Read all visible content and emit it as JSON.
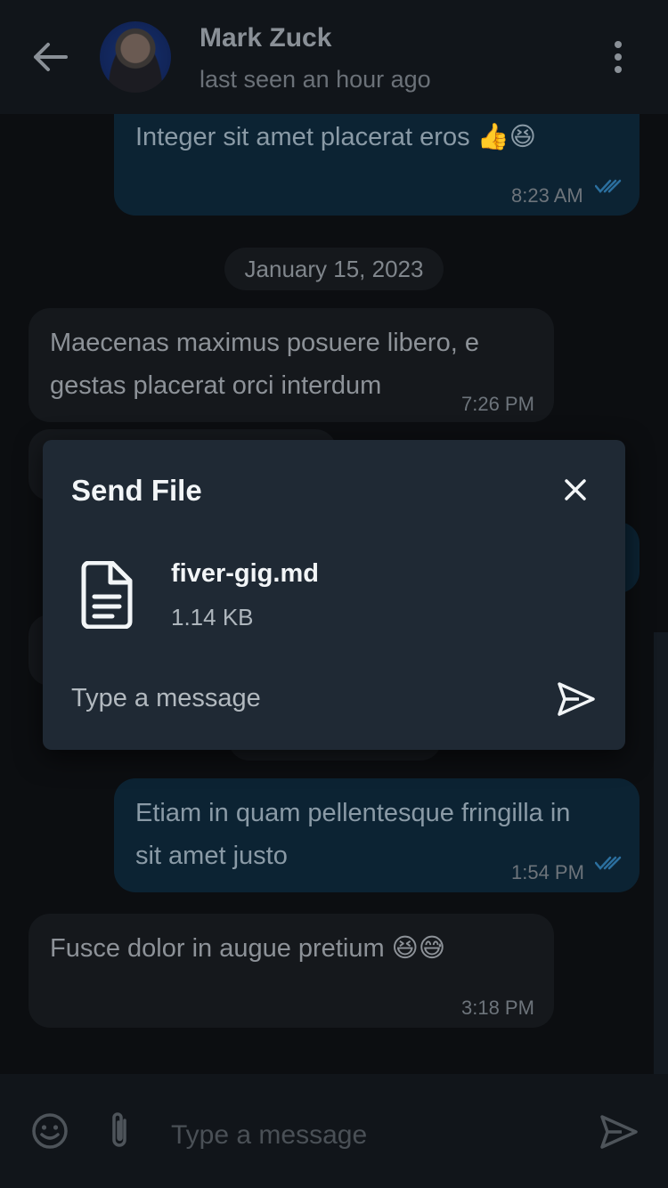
{
  "header": {
    "contact_name": "Mark Zuck",
    "status": "last seen an hour ago"
  },
  "messages": [
    {
      "direction": "out",
      "text": "Integer sit amet placerat eros 👍😆",
      "time": "8:23 AM",
      "read": true
    },
    {
      "type": "date",
      "text": "January 15, 2023"
    },
    {
      "direction": "in",
      "text": "Maecenas maximus posuere libero, e gestas placerat orci interdum",
      "line1": "Maecenas maximus posuere libero, e",
      "line2": "gestas placerat orci interdum",
      "time": "7:26 PM"
    },
    {
      "direction": "out",
      "text": "Etiam in quam pellentesque fringilla in sit amet justo",
      "line1": "Etiam in quam pellentesque fringilla in",
      "line2": "sit amet justo",
      "time": "1:54 PM",
      "read": true
    },
    {
      "direction": "in",
      "text": "Fusce dolor in augue pretium 😆😅",
      "time": "3:18 PM"
    }
  ],
  "composer": {
    "placeholder": "Type a message"
  },
  "dialog": {
    "title": "Send File",
    "file_name": "fiver-gig.md",
    "file_size": "1.14 KB",
    "input_placeholder": "Type a message"
  },
  "colors": {
    "background": "#0c0e11",
    "appbar": "#11151a",
    "outgoing_bubble": "#0c2333",
    "incoming_bubble": "#15181c",
    "dialog": "#1f2934",
    "read_ticks": "#2b6f9e"
  }
}
